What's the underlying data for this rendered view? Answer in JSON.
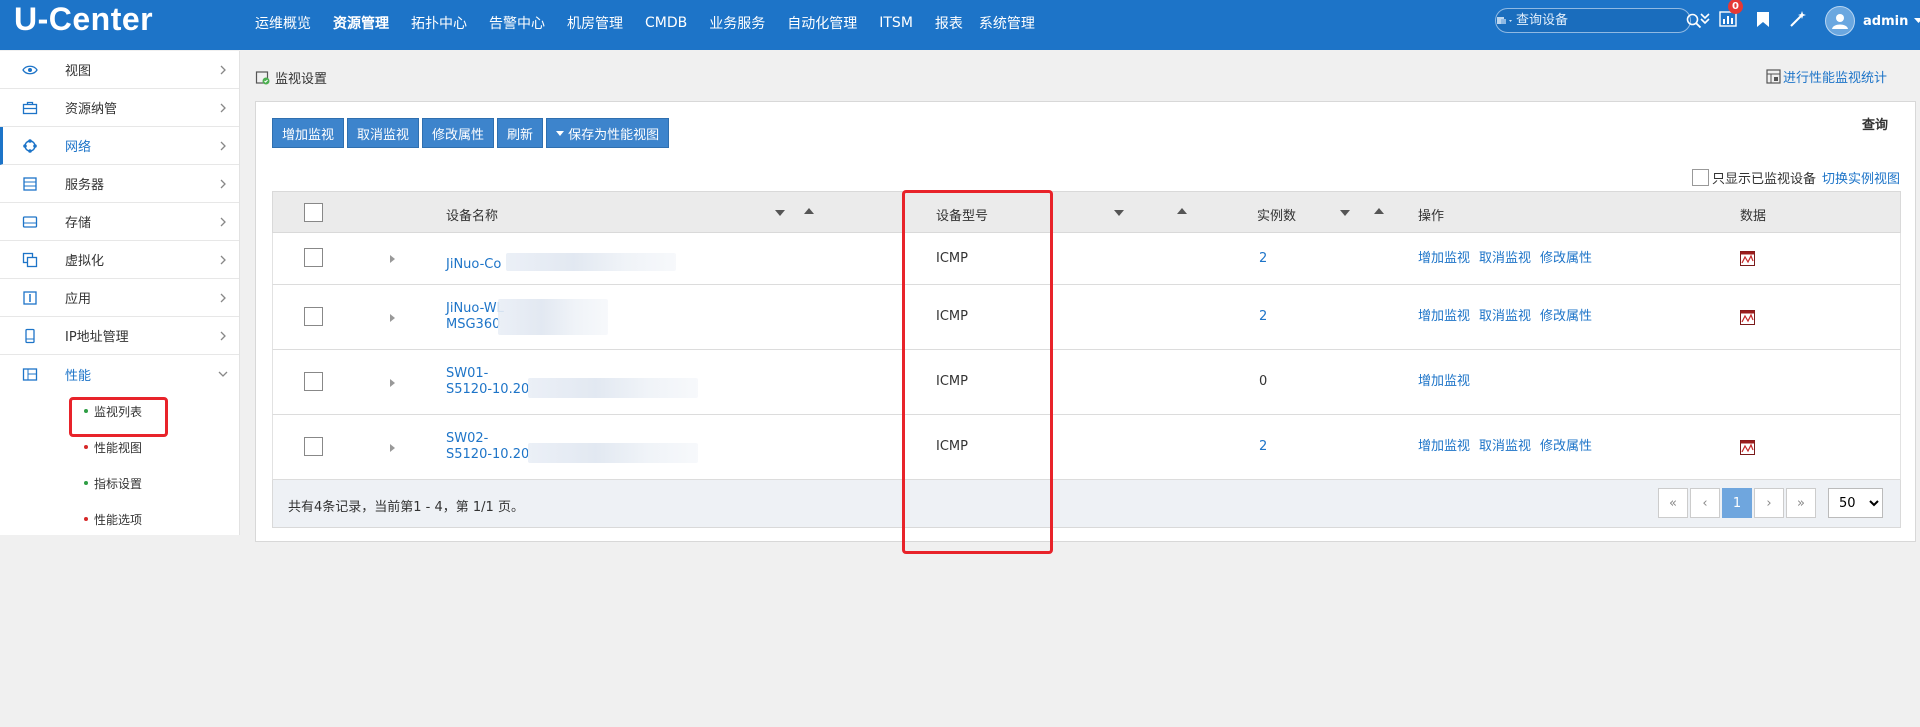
{
  "app": {
    "logo": "U-Center"
  },
  "nav": {
    "items": [
      "运维概览",
      "资源管理",
      "拓扑中心",
      "告警中心",
      "机房管理",
      "CMDB",
      "业务服务",
      "自动化管理",
      "ITSM",
      "报表",
      "系统管理"
    ],
    "active_index": 1
  },
  "search": {
    "placeholder": "查询设备"
  },
  "toolbar": {
    "notification_count": "0",
    "username": "admin"
  },
  "sidebar": {
    "items": [
      {
        "label": "视图",
        "icon": "eye-icon"
      },
      {
        "label": "资源纳管",
        "icon": "briefcase-icon"
      },
      {
        "label": "网络",
        "icon": "network-icon"
      },
      {
        "label": "服务器",
        "icon": "server-icon"
      },
      {
        "label": "存储",
        "icon": "storage-icon"
      },
      {
        "label": "虚拟化",
        "icon": "virtualization-icon"
      },
      {
        "label": "应用",
        "icon": "application-icon"
      },
      {
        "label": "IP地址管理",
        "icon": "mobile-icon"
      },
      {
        "label": "性能",
        "icon": "performance-icon"
      }
    ],
    "subitems": [
      {
        "label": "监视列表",
        "dot_color": "#2e9e44"
      },
      {
        "label": "性能视图",
        "dot_color": "#d62828"
      },
      {
        "label": "指标设置",
        "dot_color": "#2e9e44"
      },
      {
        "label": "性能选项",
        "dot_color": "#d62828"
      }
    ]
  },
  "page": {
    "breadcrumb": "监视设置",
    "stat_link": "进行性能监视统计",
    "buttons": {
      "add": "增加监视",
      "cancel": "取消监视",
      "modify": "修改属性",
      "refresh": "刷新",
      "save_view": "保存为性能视图"
    },
    "query": "查询",
    "only_monitored_label": "只显示已监视设备",
    "switch_view_label": "切换实例视图"
  },
  "table": {
    "headers": {
      "name": "设备名称",
      "model": "设备型号",
      "instances": "实例数",
      "ops": "操作",
      "data": "数据"
    },
    "rows": [
      {
        "name_line1": "JiNuo-Co",
        "name_line2": "",
        "model": "ICMP",
        "instances": "2",
        "ops": [
          "增加监视",
          "取消监视",
          "修改属性"
        ],
        "has_data": true
      },
      {
        "name_line1": "JiNuo-WL",
        "name_line2": "MSG360",
        "model": "ICMP",
        "instances": "2",
        "ops": [
          "增加监视",
          "取消监视",
          "修改属性"
        ],
        "has_data": true
      },
      {
        "name_line1": "SW01-",
        "name_line2": "S5120-10.20",
        "model": "ICMP",
        "instances": "0",
        "ops": [
          "增加监视"
        ],
        "has_data": false
      },
      {
        "name_line1": "SW02-",
        "name_line2": "S5120-10.20",
        "model": "ICMP",
        "instances": "2",
        "ops": [
          "增加监视",
          "取消监视",
          "修改属性"
        ],
        "has_data": true
      }
    ],
    "footer": "共有4条记录，当前第1 - 4，第 1/1 页。",
    "pagination": {
      "current": "1",
      "page_size": "50"
    }
  },
  "colors": {
    "brand": "#1d74c8",
    "highlight": "#e8232a"
  }
}
